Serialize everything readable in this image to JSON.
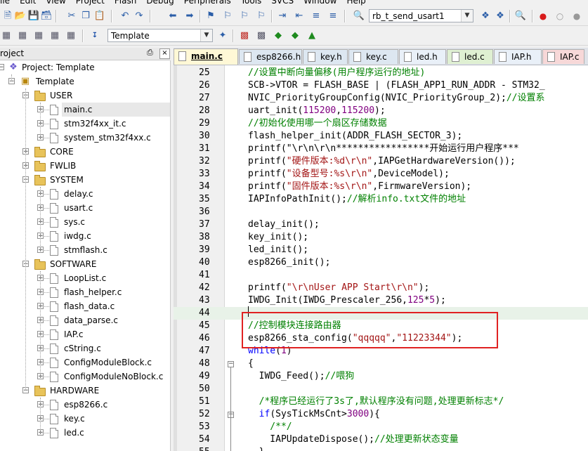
{
  "menu": [
    "ile",
    "Edit",
    "View",
    "Project",
    "Flash",
    "Debug",
    "Peripherals",
    "Tools",
    "SVCS",
    "Window",
    "Help"
  ],
  "toolbar": {
    "target_combo": "rb_t_send_usart1",
    "template_combo": "Template"
  },
  "project_panel": {
    "title": "roject",
    "pin": "p",
    "close": "×"
  },
  "tree": {
    "root": "Project: Template",
    "target": "Template",
    "groups": [
      {
        "name": "USER",
        "files": [
          "main.c",
          "stm32f4xx_it.c",
          "system_stm32f4xx.c"
        ]
      },
      {
        "name": "CORE",
        "files": []
      },
      {
        "name": "FWLIB",
        "files": []
      },
      {
        "name": "SYSTEM",
        "files": [
          "delay.c",
          "usart.c",
          "sys.c",
          "iwdg.c",
          "stmflash.c"
        ]
      },
      {
        "name": "SOFTWARE",
        "files": [
          "LoopList.c",
          "flash_helper.c",
          "flash_data.c",
          "data_parse.c",
          "IAP.c",
          "cString.c",
          "ConfigModuleBlock.c",
          "ConfigModuleNoBlock.c"
        ]
      },
      {
        "name": "HARDWARE",
        "files": [
          "esp8266.c",
          "key.c",
          "led.c"
        ]
      }
    ]
  },
  "tabs": [
    {
      "label": "main.c",
      "active": true,
      "color": "#f5e6a8"
    },
    {
      "label": "esp8266.h",
      "active": false,
      "color": "#dde7f1"
    },
    {
      "label": "key.h",
      "active": false,
      "color": "#dde7f1"
    },
    {
      "label": "key.c",
      "active": false,
      "color": "#dde7f1"
    },
    {
      "label": "led.h",
      "active": false,
      "color": "#e9f0f8"
    },
    {
      "label": "led.c",
      "active": false,
      "color": "#dff0d2"
    },
    {
      "label": "IAP.h",
      "active": false,
      "color": "#e9f0f8"
    },
    {
      "label": "IAP.c",
      "active": false,
      "color": "#f7d8d8"
    }
  ],
  "code": [
    {
      "ln": "25",
      "text": "//设置中断向量偏移(用户程序运行的地址)"
    },
    {
      "ln": "26",
      "text": "SCB->VTOR = FLASH_BASE | (FLASH_APP1_RUN_ADDR - STM32_"
    },
    {
      "ln": "27",
      "text": "NVIC_PriorityGroupConfig(NVIC_PriorityGroup_2);//设置系"
    },
    {
      "ln": "28",
      "text": "uart_init(115200,115200);"
    },
    {
      "ln": "29",
      "text": "//初始化使用哪一个扇区存储数据"
    },
    {
      "ln": "30",
      "text": "flash_helper_init(ADDR_FLASH_SECTOR_3);"
    },
    {
      "ln": "31",
      "text": "printf(\"\\r\\n\\r\\n*****************开始运行用户程序***"
    },
    {
      "ln": "32",
      "text": "printf(\"硬件版本:%d\\r\\n\",IAPGetHardwareVersion());"
    },
    {
      "ln": "33",
      "text": "printf(\"设备型号:%s\\r\\n\",DeviceModel);"
    },
    {
      "ln": "34",
      "text": "printf(\"固件版本:%s\\r\\n\",FirmwareVersion);"
    },
    {
      "ln": "35",
      "text": "IAPInfoPathInit();//解析info.txt文件的地址"
    },
    {
      "ln": "36",
      "text": ""
    },
    {
      "ln": "37",
      "text": "delay_init();"
    },
    {
      "ln": "38",
      "text": "key_init();"
    },
    {
      "ln": "39",
      "text": "led_init();"
    },
    {
      "ln": "40",
      "text": "esp8266_init();"
    },
    {
      "ln": "41",
      "text": ""
    },
    {
      "ln": "42",
      "text": "printf(\"\\r\\nUser APP Start\\r\\n\");"
    },
    {
      "ln": "43",
      "text": "IWDG_Init(IWDG_Prescaler_256,125*5);"
    },
    {
      "ln": "44",
      "text": ""
    },
    {
      "ln": "45",
      "text": "//控制模块连接路由器"
    },
    {
      "ln": "46",
      "text": "esp8266_sta_config(\"qqqqq\",\"11223344\");"
    },
    {
      "ln": "47",
      "text": "while(1)"
    },
    {
      "ln": "48",
      "text": "{"
    },
    {
      "ln": "49",
      "text": "  IWDG_Feed();//喂狗"
    },
    {
      "ln": "50",
      "text": ""
    },
    {
      "ln": "51",
      "text": "  /*程序已经运行了3s了,默认程序没有问题,处理更新标志*/"
    },
    {
      "ln": "52",
      "text": "  if(SysTickMsCnt>3000){"
    },
    {
      "ln": "53",
      "text": "    /**/"
    },
    {
      "ln": "54",
      "text": "    IAPUpdateDispose();//处理更新状态变量"
    },
    {
      "ln": "55",
      "text": "  }"
    }
  ],
  "colors": {
    "highlight_box": "#e02222",
    "comment": "#008000",
    "string": "#a31515",
    "keyword": "#0000ff"
  }
}
